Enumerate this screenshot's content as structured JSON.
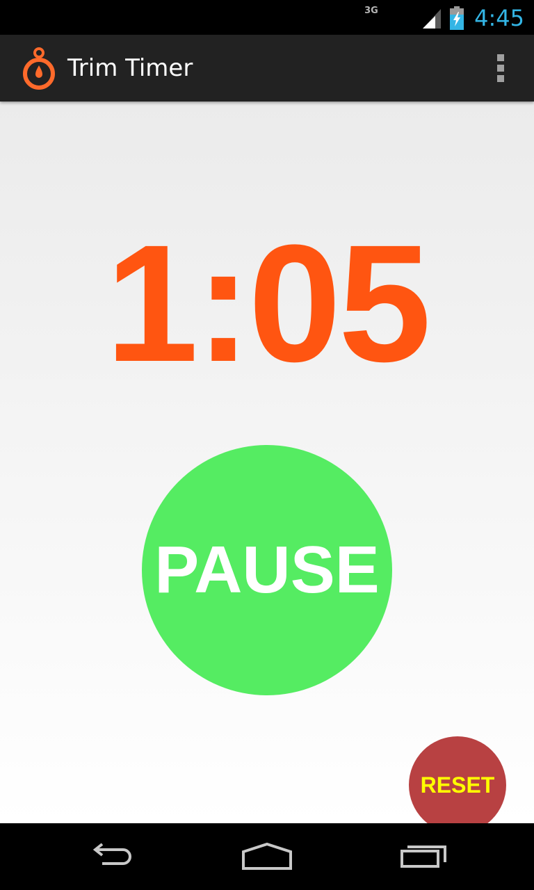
{
  "status_bar": {
    "network_type": "3G",
    "time": "4:45",
    "accent_color": "#33b5e5"
  },
  "action_bar": {
    "title": "Trim Timer",
    "app_icon": "stopwatch-icon",
    "overflow_icon": "overflow-menu-icon"
  },
  "timer": {
    "display": "1:05",
    "color": "#ff5511"
  },
  "controls": {
    "pause_label": "PAUSE",
    "pause_color": "#55ec62",
    "reset_label": "RESET",
    "reset_color": "#b84142",
    "reset_text_color": "#ffff00"
  },
  "nav_bar": {
    "back_icon": "back-icon",
    "home_icon": "home-icon",
    "recent_icon": "recent-apps-icon"
  }
}
